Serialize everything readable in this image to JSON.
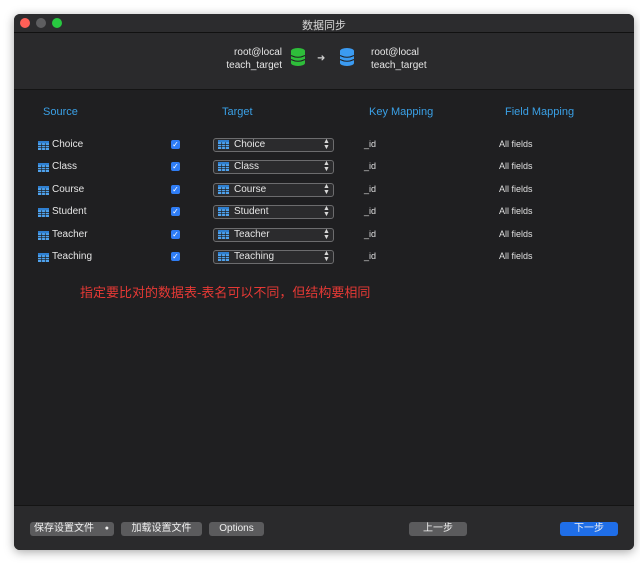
{
  "window": {
    "title": "数据同步"
  },
  "connection": {
    "source": {
      "host": "root@local",
      "database": "teach_target",
      "color": "#2ebd3a"
    },
    "target": {
      "host": "root@local",
      "database": "teach_target",
      "color": "#3b9bf2"
    }
  },
  "columns": {
    "source": "Source",
    "target": "Target",
    "key_mapping": "Key Mapping",
    "field_mapping": "Field Mapping"
  },
  "rows": [
    {
      "source": "Choice",
      "checked": true,
      "target": "Choice",
      "key": "_id",
      "fields": "All fields"
    },
    {
      "source": "Class",
      "checked": true,
      "target": "Class",
      "key": "_id",
      "fields": "All fields"
    },
    {
      "source": "Course",
      "checked": true,
      "target": "Course",
      "key": "_id",
      "fields": "All fields"
    },
    {
      "source": "Student",
      "checked": true,
      "target": "Student",
      "key": "_id",
      "fields": "All fields"
    },
    {
      "source": "Teacher",
      "checked": true,
      "target": "Teacher",
      "key": "_id",
      "fields": "All fields"
    },
    {
      "source": "Teaching",
      "checked": true,
      "target": "Teaching",
      "key": "_id",
      "fields": "All fields"
    }
  ],
  "annotation": "指定要比对的数据表-表名可以不同，但结构要相同",
  "footer": {
    "save_settings": "保存设置文件",
    "load_settings": "加载设置文件",
    "options": "Options",
    "previous": "上一步",
    "next": "下一步"
  },
  "icons": {
    "source_db": "database-icon",
    "target_db": "database-icon",
    "arrow": "arrow-right-icon",
    "table": "table-icon",
    "checkbox": "checkmark-icon",
    "select_caret": "chevron-updown-icon"
  }
}
